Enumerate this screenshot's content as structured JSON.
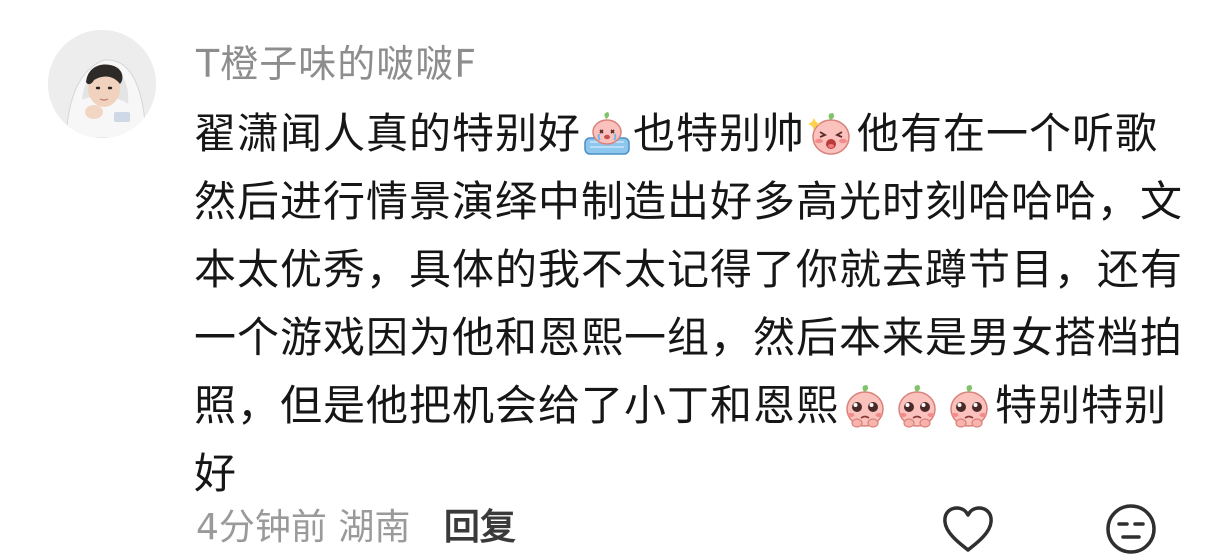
{
  "comment": {
    "username": "T橙子味的啵啵F",
    "lines": [
      {
        "t1": "翟潇闻人真的特别好",
        "e1": "crying-blanket-emoji",
        "t2": "也特别帅",
        "e2": "excited-blush-emoji",
        "t3": "他有在一个听歌"
      },
      {
        "t1": "然后进行情景演绎中制造出好多高光时刻哈哈哈，文"
      },
      {
        "t1": "本太优秀，具体的我不太记得了你就去蹲节目，还有"
      },
      {
        "t1": "一个游戏因为他和恩熙一组，然后本来是男女搭档拍"
      },
      {
        "t1": "照，但是他把机会给了小丁和恩熙",
        "e_repeat": [
          "pleading-emoji",
          "pleading-emoji",
          "pleading-emoji"
        ],
        "t2": "特别特别"
      },
      {
        "t1": "好"
      }
    ],
    "time_ago": "4分钟前",
    "location": "湖南",
    "reply_label": "回复",
    "like_icon": "heart-icon",
    "dislike_icon": "unamused-face-icon"
  },
  "colors": {
    "username": "#8d8d8d",
    "text": "#161616",
    "meta": "#9a9a9a",
    "reply": "#3a3a3a",
    "emoji_pink": "#f8b0ae",
    "emoji_blue": "#8ec7ee"
  }
}
